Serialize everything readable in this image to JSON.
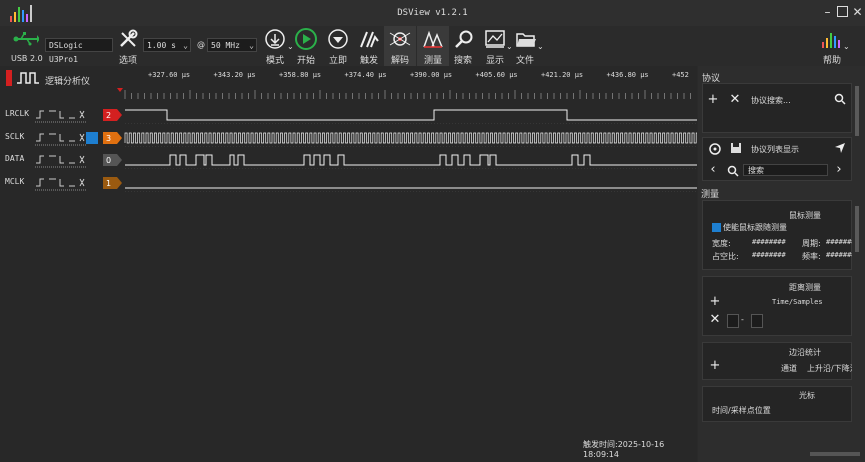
{
  "window": {
    "title": "DSView v1.2.1"
  },
  "toolbar": {
    "device_label": "USB 2.0",
    "device_name": "DSLogic U3Pro1",
    "options_label": "选项",
    "sample_time": "1.00 s",
    "at_sign": "@",
    "sample_rate": "50 MHz",
    "mode_label": "模式",
    "start_label": "开始",
    "instant_label": "立即",
    "trigger_label": "触发",
    "decode_label": "解码",
    "measure_label": "测量",
    "search_label": "搜索",
    "display_label": "显示",
    "file_label": "文件",
    "help_label": "帮助"
  },
  "canvas": {
    "header_label": "逻辑分析仪",
    "ruler_ticks": [
      "+327.60 μs",
      "+343.20 μs",
      "+358.80 μs",
      "+374.40 μs",
      "+390.00 μs",
      "+405.60 μs",
      "+421.20 μs",
      "+436.80 μs",
      "+452"
    ],
    "channels": [
      {
        "name": "LRCLK",
        "index": "2",
        "color": "#d42020"
      },
      {
        "name": "SCLK",
        "index": "3",
        "color": "#e07010"
      },
      {
        "name": "DATA",
        "index": "0",
        "color": "#555555"
      },
      {
        "name": "MCLK",
        "index": "1",
        "color": "#9a5a10"
      }
    ],
    "trigger_time": "触发时间:2025-10-16 18:09:14"
  },
  "protocol": {
    "title": "协议",
    "search_placeholder": "协议搜索...",
    "list_display": "协议列表显示",
    "search2_placeholder": "搜索"
  },
  "measure": {
    "title": "测量",
    "mouse_title": "鼠标测量",
    "enable_follow": "使能鼠标跟随测量",
    "width_label": "宽度:",
    "width_value": "########",
    "period_label": "周期:",
    "period_value": "########",
    "duty_label": "占空比:",
    "duty_value": "########",
    "freq_label": "频率:",
    "freq_value": "########",
    "distance_title": "距离测量",
    "time_samples": "Time/Samples",
    "dash": "-",
    "edge_title": "边沿统计",
    "channel_label": "通道",
    "edge_label": "上升沿/下降沿",
    "cursor_title": "光标",
    "cursor_label": "时间/采样点位置"
  },
  "colors": {
    "accent_green": "#2bb04a",
    "decode_blue": "#1e7fd0"
  }
}
